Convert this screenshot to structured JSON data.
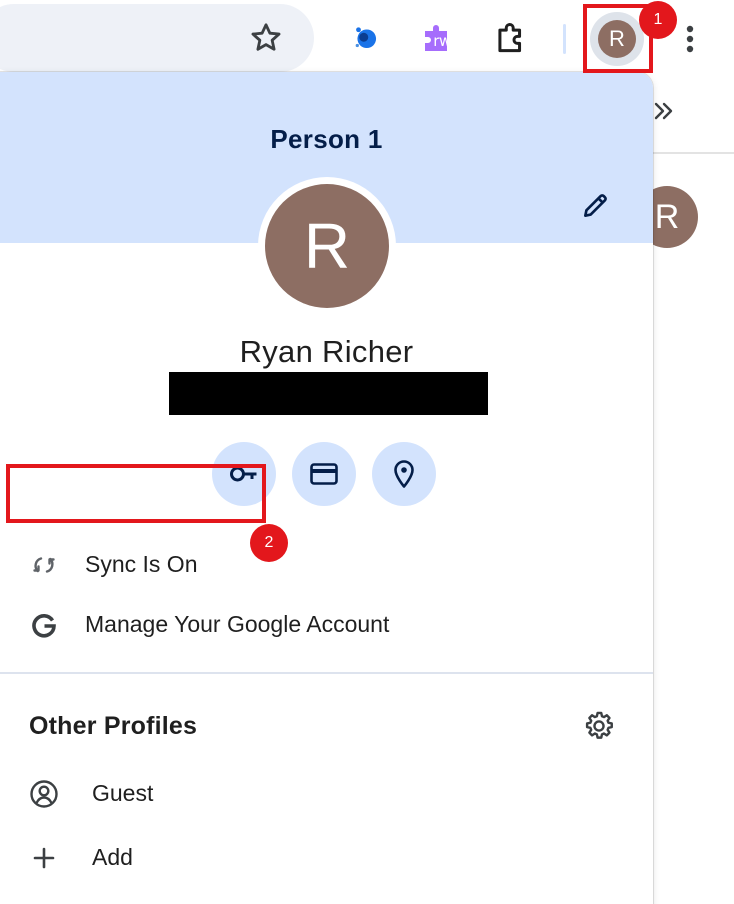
{
  "toolbar": {
    "bookmark_icon": "star-outline-icon",
    "extensions": [
      {
        "name": "blue-extension-icon"
      },
      {
        "name": "rw-extension-icon",
        "label": "rw",
        "color": "#a66dfc"
      },
      {
        "name": "extensions-puzzle-icon"
      }
    ],
    "profile_initial": "R",
    "menu_icon": "three-dots-vertical-icon"
  },
  "annotations": {
    "badge_1": "1",
    "badge_2": "2",
    "highlight_color": "#e3171c"
  },
  "background_page": {
    "avatar_initial": "R"
  },
  "profile_panel": {
    "profile_label": "Person 1",
    "avatar_initial": "R",
    "user_name": "Ryan Richer",
    "quick_actions": [
      {
        "name": "passwords",
        "icon": "key-icon"
      },
      {
        "name": "payment-methods",
        "icon": "credit-card-icon"
      },
      {
        "name": "addresses",
        "icon": "location-pin-icon"
      }
    ],
    "menu": {
      "sync_label": "Sync Is On",
      "manage_label": "Manage Your Google Account"
    },
    "other_profiles": {
      "title": "Other Profiles",
      "guest_label": "Guest",
      "add_label": "Add"
    }
  },
  "colors": {
    "header_bg": "#d3e3fd",
    "avatar_bg": "#8d6e63",
    "header_text": "#041e49"
  }
}
